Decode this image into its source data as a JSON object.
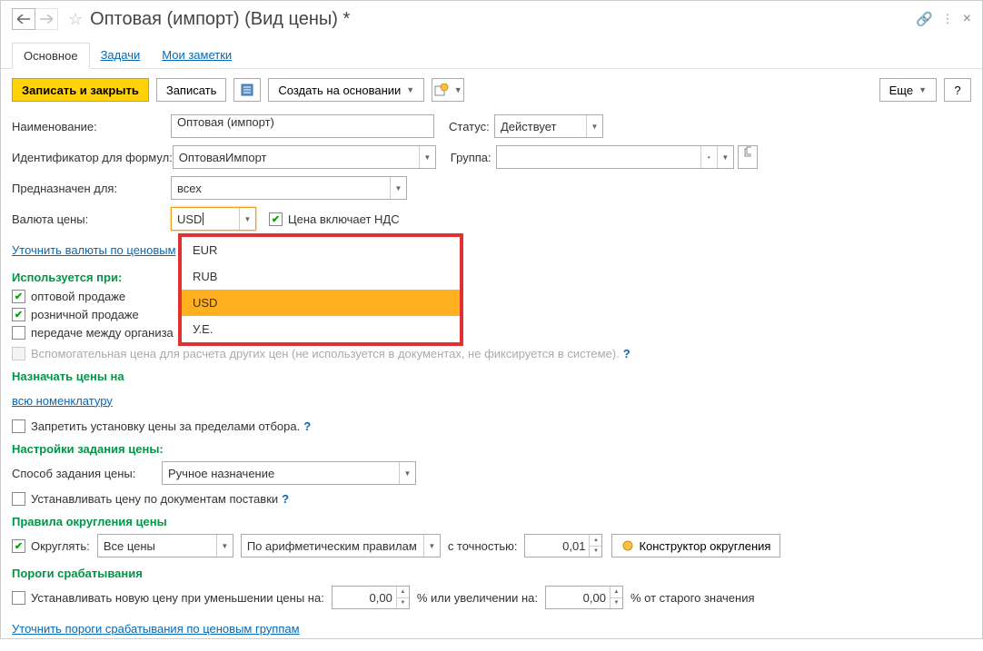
{
  "title": "Оптовая (импорт) (Вид цены) *",
  "tabs": {
    "main": "Основное",
    "tasks": "Задачи",
    "notes": "Мои заметки"
  },
  "toolbar": {
    "save_close": "Записать и закрыть",
    "save": "Записать",
    "create_based": "Создать на основании",
    "more": "Еще",
    "help": "?"
  },
  "fields": {
    "name_label": "Наименование:",
    "name_value": "Оптовая (импорт)",
    "status_label": "Статус:",
    "status_value": "Действует",
    "id_label": "Идентификатор для формул:",
    "id_value": "ОптоваяИмпорт",
    "group_label": "Группа:",
    "group_value": "",
    "purpose_label": "Предназначен для:",
    "purpose_value": "всех",
    "currency_label": "Валюта цены:",
    "currency_value": "USD",
    "vat_inc": "Цена включает НДС",
    "refine_currencies": "Уточнить валюты по ценовым",
    "used_at": "Используется при:",
    "wholesale": "оптовой продаже",
    "retail": "розничной продаже",
    "transfer": "передаче между организа",
    "aux_price": "Вспомогательная цена для расчета других цен (не используется в документах, не фиксируется в системе).",
    "assign_prices": "Назначать цены на",
    "all_nomenclature": "всю номенклатуру",
    "forbid_outside": "Запретить установку цены за пределами отбора.",
    "price_settings": "Настройки задания цены:",
    "method_label": "Способ задания цены:",
    "method_value": "Ручное назначение",
    "set_by_docs": "Устанавливать цену по документам поставки",
    "rounding_rules": "Правила округления цены",
    "round": "Округлять:",
    "all_prices": "Все цены",
    "arith_rules": "По арифметическим правилам",
    "precision": "с точностью:",
    "precision_val": "0,01",
    "constructor": "Конструктор округления",
    "thresholds": "Пороги срабатывания",
    "set_new_price": "Устанавливать новую цену при уменьшении цены на:",
    "dec_val": "0,00",
    "percent_or": "%   или увеличении на:",
    "inc_val": "0,00",
    "percent_of_old": "% от старого значения",
    "refine_thresholds": "Уточнить пороги срабатывания по ценовым группам"
  },
  "currency_options": [
    "EUR",
    "RUB",
    "USD",
    "У.Е."
  ]
}
